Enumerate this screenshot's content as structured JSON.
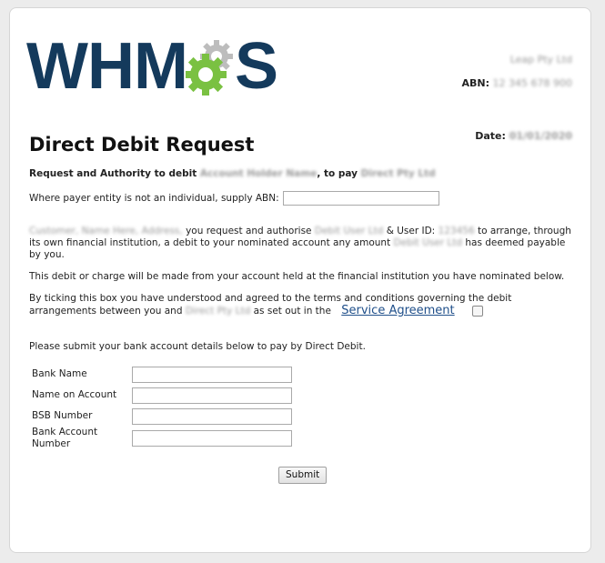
{
  "logo": {
    "prefix": "WHM",
    "suffix": "S",
    "gear_icon": "gear-icon"
  },
  "company": {
    "name": "Leap Pty Ltd",
    "abn_label": "ABN:",
    "abn_value": "12 345 678 900"
  },
  "date": {
    "label": "Date:",
    "value": "01/01/2020"
  },
  "title": "Direct Debit Request",
  "authority": {
    "part1": "Request and Authority to debit",
    "payer": "Account Holder Name",
    "part2": ", to pay",
    "payee": "Direct Pty Ltd"
  },
  "abn_prompt": "Where payer entity is not an individual, supply ABN:",
  "request_paragraph": {
    "names": "Customer, Name Here, Address,",
    "text1": "you request and authorise",
    "debit_user": "Debit User Ltd",
    "text2": "& User ID:",
    "user_id": "123456",
    "text3": "to arrange, through its own financial institution, a debit to your nominated account any amount",
    "company": "Debit User Ltd",
    "text4": "has deemed payable by you."
  },
  "debit_paragraph": "This debit or charge will be made from your account held at the financial institution you have nominated below.",
  "agreement": {
    "text1": "By ticking this box you have understood and agreed to the terms and conditions governing the debit arrangements between you and",
    "company": "Direct Pty Ltd",
    "text2": "as set out in the",
    "link": "Service Agreement"
  },
  "bank_prompt": "Please submit your bank account details below to pay by Direct Debit.",
  "bank_fields": [
    {
      "label": "Bank Name"
    },
    {
      "label": "Name on Account"
    },
    {
      "label": "BSB Number"
    },
    {
      "label": "Bank Account Number"
    }
  ],
  "submit_label": "Submit",
  "colors": {
    "brand_navy": "#143a5c",
    "brand_green": "#7ac142",
    "link": "#1f4f8a"
  }
}
